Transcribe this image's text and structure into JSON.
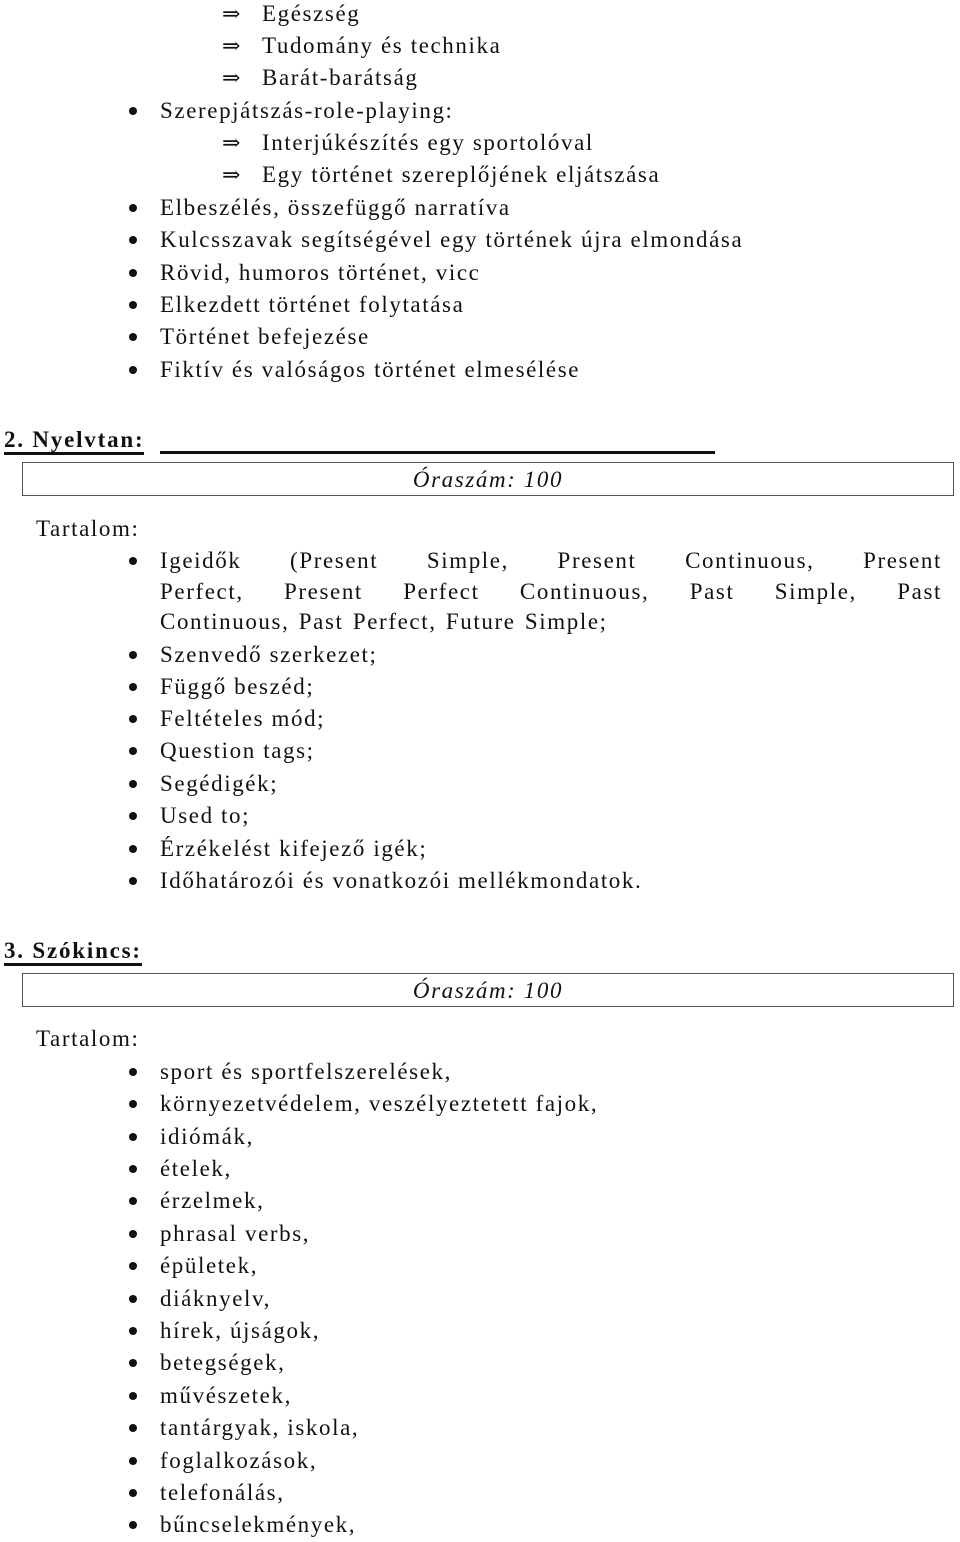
{
  "intro_list": {
    "sub_items_a": [
      {
        "icon": "double-arrow-right",
        "label": "Egészség"
      },
      {
        "icon": "double-arrow-right",
        "label": "Tudomány és technika"
      },
      {
        "icon": "double-arrow-right",
        "label": "Barát-barátság"
      }
    ],
    "roleplay": {
      "label": "Szerepjátszás-role-playing:",
      "sub_items": [
        {
          "icon": "double-arrow-right",
          "label": "Interjúkészítés egy sportolóval"
        },
        {
          "icon": "double-arrow-right",
          "label": "Egy történet szereplőjének eljátszása"
        }
      ]
    },
    "items": [
      "Elbeszélés, összefüggő narratíva",
      "Kulcsszavak segítségével egy történek újra elmondása",
      "Rövid, humoros történet, vicc",
      "Elkezdett történet folytatása",
      "Történet befejezése",
      "Fiktív és valóságos történet elmesélése"
    ]
  },
  "sections": [
    {
      "heading": "2. Nyelvtan:",
      "hours_label": "Óraszám: 100",
      "content_label": "Tartalom:",
      "first_item_lines": [
        "Igeidők (Present Simple, Present Continuous, Present",
        "Perfect, Present Perfect Continuous, Past Simple, Past",
        "Continuous, Past Perfect, Future Simple;"
      ],
      "items": [
        "Szenvedő szerkezet;",
        "Függő beszéd;",
        "Feltételes mód;",
        "Question tags;",
        "Segédigék;",
        "Used to;",
        "Érzékelést kifejező igék;",
        "Időhatározói és vonatkozói mellékmondatok."
      ]
    },
    {
      "heading": "3. Szókincs:",
      "hours_label": "Óraszám: 100",
      "content_label": "Tartalom:",
      "items": [
        "sport és sportfelszerelések,",
        "környezetvédelem, veszélyeztetett fajok,",
        "idiómák,",
        "ételek,",
        "érzelmek,",
        "phrasal verbs,",
        "épületek,",
        "diáknyelv,",
        "hírek, újságok,",
        "betegségek,",
        "művészetek,",
        "tantárgyak, iskola,",
        "foglalkozások,",
        "telefonálás,",
        "bűncselekmények,"
      ]
    }
  ],
  "glyphs": {
    "double_arrow": "⇒"
  }
}
